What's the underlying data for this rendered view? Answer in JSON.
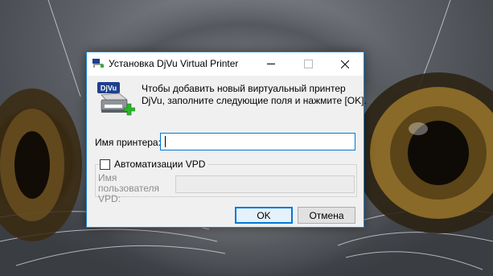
{
  "window": {
    "title": "Установка DjVu Virtual Printer",
    "accent": "#0078d7"
  },
  "icons": {
    "title": "djvu-printer-icon",
    "main": "djvu-printer-add-icon",
    "minimize": "minimize-icon",
    "maximize": "maximize-icon",
    "close": "close-icon",
    "badge_text": "DjVu"
  },
  "message": {
    "line1": "Чтобы добавить новый виртуальный принтер",
    "line2": "DjVu, заполните следующие поля и нажмите [OK]."
  },
  "printer_name": {
    "label": "Имя принтера:",
    "value": ""
  },
  "vpd": {
    "checkbox_label": "Автоматизации VPD",
    "checked": false,
    "user_label_line1": "Имя пользователя",
    "user_label_line2": "VPD:",
    "user_value": ""
  },
  "buttons": {
    "ok": "OK",
    "cancel": "Отмена"
  }
}
